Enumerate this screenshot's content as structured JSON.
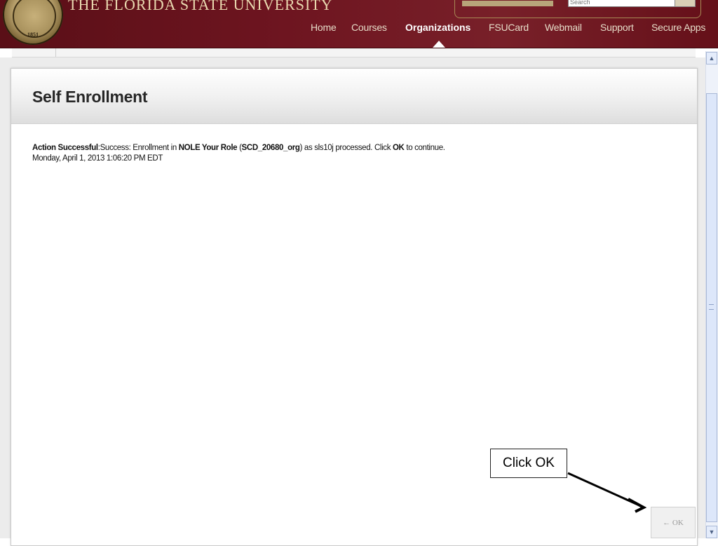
{
  "header": {
    "university": "THE FLORIDA STATE UNIVERSITY",
    "seal_year": "1851",
    "search_placeholder": "Search",
    "nav": [
      {
        "label": "Home"
      },
      {
        "label": "Courses"
      },
      {
        "label": "Organizations",
        "active": true
      },
      {
        "label": "FSUCard"
      },
      {
        "label": "Webmail"
      },
      {
        "label": "Support"
      },
      {
        "label": "Secure Apps"
      }
    ]
  },
  "page": {
    "title": "Self Enrollment",
    "message": {
      "status_label": "Action Successful",
      "part1": ":Success: Enrollment in ",
      "org_name": "NOLE Your Role",
      "part2": " (",
      "org_id": "SCD_20680_org",
      "part3": ") as sls10j processed. Click ",
      "ok_word": "OK",
      "part4": " to continue.",
      "timestamp": "Monday, April 1, 2013 1:06:20 PM EDT"
    },
    "ok_button": "← OK"
  },
  "annotation": {
    "callout": "Click OK"
  },
  "colors": {
    "header_maroon": "#6e1520",
    "title_gold": "#e9d9b0",
    "nav_text": "#e6dcc8"
  }
}
